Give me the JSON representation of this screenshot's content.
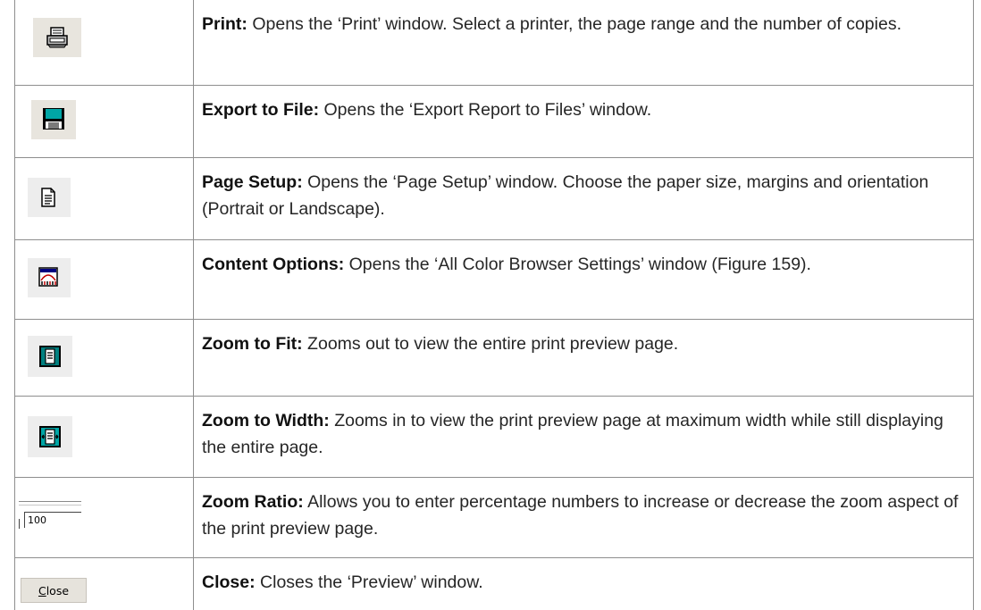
{
  "rows": [
    {
      "icon": "printer-icon",
      "term": "Print:",
      "text": " Opens the ‘Print’ window. Select a printer, the page range and the number of copies."
    },
    {
      "icon": "floppy-disk-icon",
      "term": "Export to File:",
      "text": " Opens the ‘Export Report to Files’ window."
    },
    {
      "icon": "page-setup-icon",
      "term": "Page Setup:",
      "text": " Opens the ‘Page Setup’ window. Choose the paper size, margins and orientation (Portrait or Landscape)."
    },
    {
      "icon": "content-options-icon",
      "term": "Content Options:",
      "text": " Opens the ‘All Color Browser Settings’ window (Figure 159)."
    },
    {
      "icon": "zoom-to-fit-icon",
      "term": "Zoom to Fit:",
      "text": " Zooms out to view the entire print preview page."
    },
    {
      "icon": "zoom-to-width-icon",
      "term": "Zoom to Width:",
      "text": " Zooms in to view the print preview page at maximum width while still displaying the entire page."
    },
    {
      "icon": "zoom-ratio-field",
      "term": "Zoom Ratio:",
      "text": " Allows you to enter percentage numbers to increase or decrease the zoom aspect of the print preview page."
    },
    {
      "icon": "close-button",
      "term": "Close:",
      "text": " Closes the ‘Preview’ window."
    }
  ],
  "zoom_ratio_value": "100",
  "close_button": {
    "mnemonic": "C",
    "rest": "lose"
  }
}
